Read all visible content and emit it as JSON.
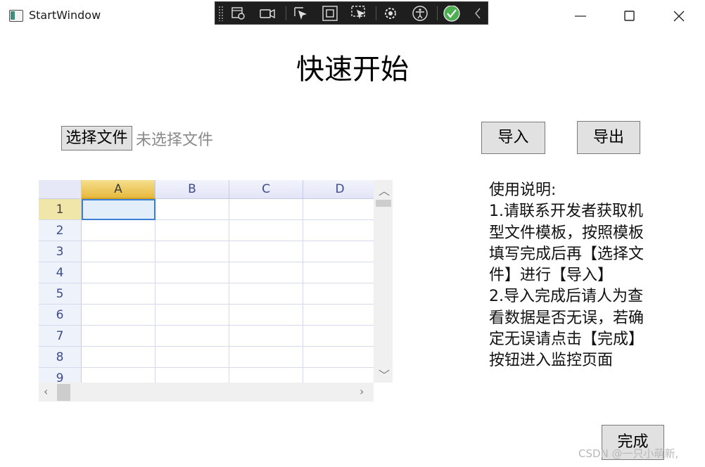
{
  "window": {
    "title": "StartWindow"
  },
  "devtools": {
    "tools": [
      "live-visual-tree-icon",
      "record-icon",
      "select-element-icon",
      "display-layout-adorners-icon",
      "track-focus-icon",
      "binding-failures-icon",
      "accessibility-checker-icon",
      "hot-reload-ok-icon",
      "collapse-icon"
    ]
  },
  "page": {
    "title": "快速开始",
    "choose_file_label": "选择文件",
    "file_status": "未选择文件",
    "import_label": "导入",
    "export_label": "导出",
    "done_label": "完成"
  },
  "grid": {
    "columns": [
      "A",
      "B",
      "C",
      "D"
    ],
    "rows": [
      "1",
      "2",
      "3",
      "4",
      "5",
      "6",
      "7",
      "8",
      "9"
    ],
    "active_column": "A",
    "active_row": "1"
  },
  "instructions": {
    "lines": [
      "使用说明:",
      "1.请联系开发者获取机",
      "型文件模板，按照模板",
      "填写完成后再【选择文",
      "件】进行【导入】",
      "2.导入完成后请人为查",
      "看数据是否无误，若确",
      "定无误请点击【完成】",
      "按钮进入监控页面"
    ]
  },
  "watermark": "CSDN @一只小萌新,",
  "colors": {
    "accent": "#3a7fd5",
    "active_header": "#e6b93c",
    "devbar": "#1e1e1e"
  }
}
